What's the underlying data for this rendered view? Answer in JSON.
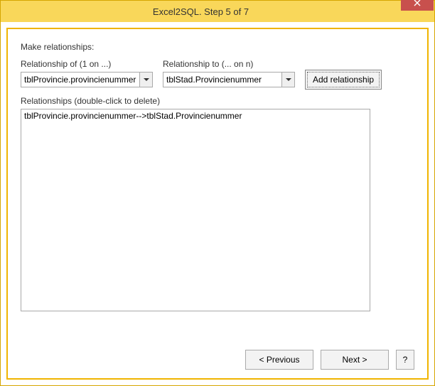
{
  "window": {
    "title": "Excel2SQL. Step 5 of 7"
  },
  "labels": {
    "make_relationships": "Make relationships:",
    "relationship_of": "Relationship of (1 on ...)",
    "relationship_to": "Relationship to (... on n)",
    "relationships_list": "Relationships (double-click to delete)"
  },
  "combos": {
    "from_value": "tblProvincie.provincienummer",
    "to_value": "tblStad.Provincienummer"
  },
  "buttons": {
    "add": "Add relationship",
    "previous": "< Previous",
    "next": "Next >",
    "help": "?"
  },
  "relationships": [
    "tblProvincie.provincienummer-->tblStad.Provincienummer"
  ]
}
